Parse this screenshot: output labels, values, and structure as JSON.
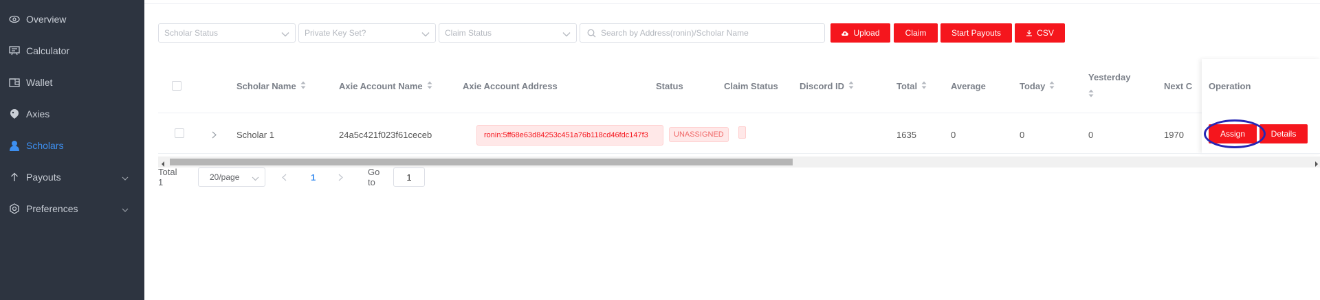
{
  "sidebar": {
    "items": [
      {
        "label": "Overview",
        "icon": "eye-icon",
        "active": false
      },
      {
        "label": "Calculator",
        "icon": "calculator-icon",
        "active": false
      },
      {
        "label": "Wallet",
        "icon": "wallet-icon",
        "active": false
      },
      {
        "label": "Axies",
        "icon": "axie-icon",
        "active": false
      },
      {
        "label": "Scholars",
        "icon": "user-icon",
        "active": true
      },
      {
        "label": "Payouts",
        "icon": "arrow-up-icon",
        "active": false,
        "expandable": true
      },
      {
        "label": "Preferences",
        "icon": "gear-icon",
        "active": false,
        "expandable": true
      }
    ]
  },
  "filters": {
    "scholar_status_placeholder": "Scholar Status",
    "private_key_placeholder": "Private Key Set?",
    "claim_status_placeholder": "Claim Status",
    "search_placeholder": "Search by Address(ronin)/Scholar Name"
  },
  "toolbar": {
    "upload_label": "Upload",
    "claim_label": "Claim",
    "start_payouts_label": "Start Payouts",
    "csv_label": "CSV"
  },
  "table": {
    "columns": {
      "scholar_name": "Scholar Name",
      "axie_account_name": "Axie Account Name",
      "axie_account_address": "Axie Account Address",
      "status": "Status",
      "claim_status": "Claim Status",
      "discord_id": "Discord ID",
      "total": "Total",
      "average": "Average",
      "today": "Today",
      "yesterday": "Yesterday",
      "next": "Next C",
      "operation": "Operation"
    },
    "rows": [
      {
        "scholar_name": "Scholar 1",
        "axie_account_name": "24a5c421f023f61ceceb",
        "axie_account_address": "ronin:5ff68e63d84253c451a76b118cd46fdc147f3",
        "status": "UNASSIGNED",
        "claim_status": "",
        "discord_id": "",
        "total": "1635",
        "average": "0",
        "today": "0",
        "yesterday": "0",
        "next": "1970",
        "assign_label": "Assign",
        "details_label": "Details"
      }
    ]
  },
  "pagination": {
    "total_text": "Total 1",
    "page_size": "20/page",
    "current_page": "1",
    "goto_label": "Go to",
    "goto_value": "1"
  },
  "colors": {
    "sidebar_bg": "#2d3440",
    "accent_blue": "#3d8ff0",
    "primary_red": "#f5161d",
    "highlight_circle": "#2626b4"
  }
}
